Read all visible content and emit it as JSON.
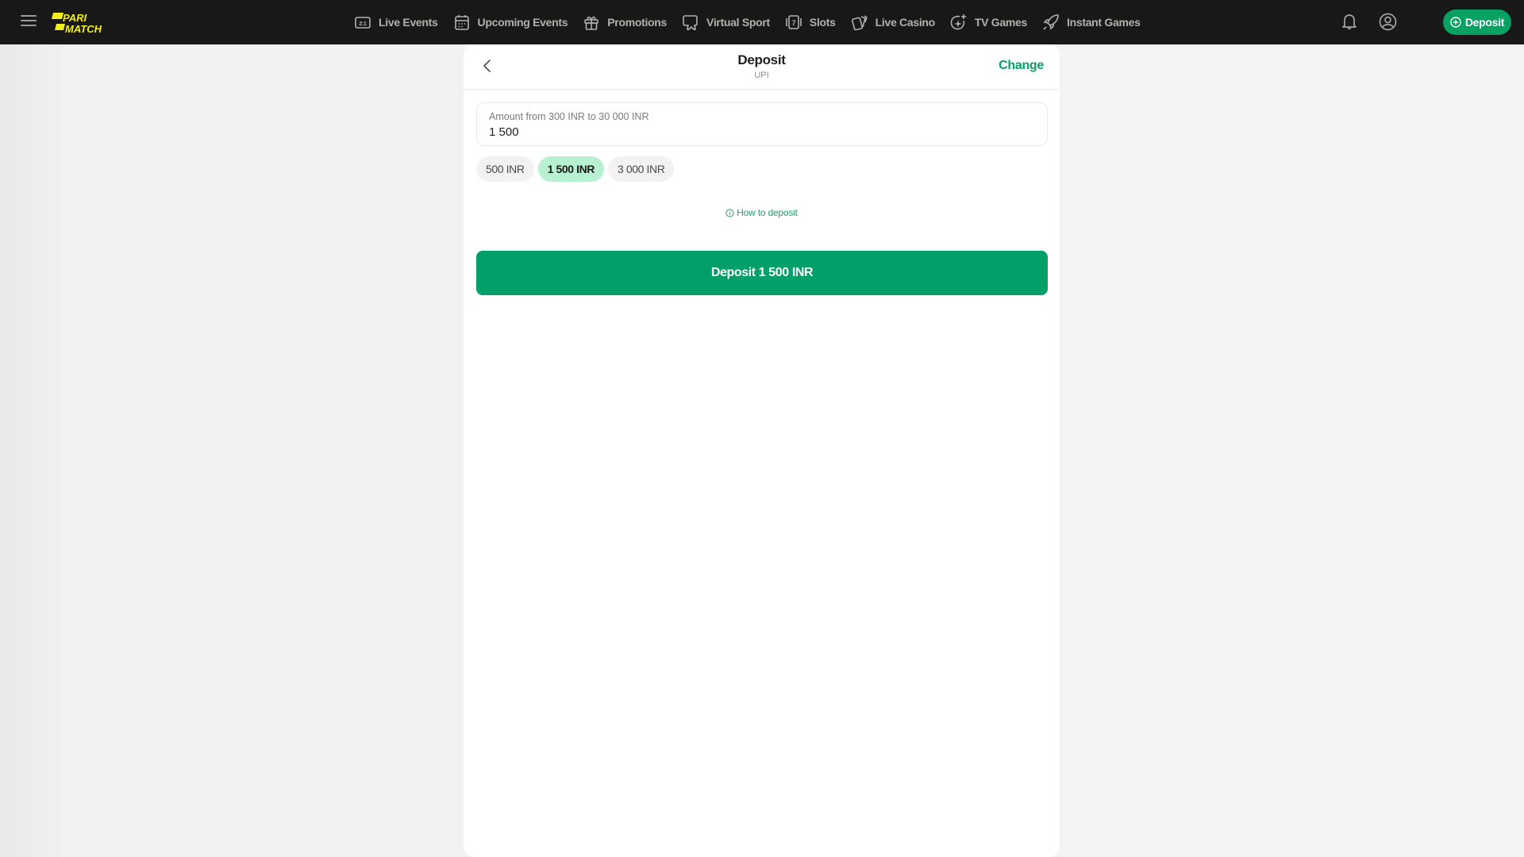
{
  "header": {
    "logo_line1": "PARI",
    "logo_line2": "MATCH",
    "nav": [
      {
        "label": "Live Events",
        "icon": "live-events-icon"
      },
      {
        "label": "Upcoming Events",
        "icon": "calendar-icon"
      },
      {
        "label": "Promotions",
        "icon": "gift-icon"
      },
      {
        "label": "Virtual Sport",
        "icon": "virtual-sport-icon"
      },
      {
        "label": "Slots",
        "icon": "slots-icon"
      },
      {
        "label": "Live Casino",
        "icon": "cards-icon"
      },
      {
        "label": "TV Games",
        "icon": "tv-games-icon"
      },
      {
        "label": "Instant Games",
        "icon": "rocket-icon"
      }
    ],
    "live_badge": "2:1",
    "slots_badge": "7",
    "deposit_label": "Deposit"
  },
  "panel": {
    "title": "Deposit",
    "subtitle": "UPI",
    "change_label": "Change",
    "amount": {
      "label": "Amount from 300 INR to 30 000 INR",
      "value": "1 500"
    },
    "chips": [
      {
        "label": "500 INR",
        "selected": false
      },
      {
        "label": "1 500 INR",
        "selected": true
      },
      {
        "label": "3 000 INR",
        "selected": false
      }
    ],
    "how_to_label": "How to deposit",
    "submit_label": "Deposit 1 500 INR"
  },
  "colors": {
    "brand_green": "#02a068",
    "logo_yellow": "#f4ed1e",
    "topbar_bg": "#181818",
    "chip_selected_bg": "#b7f1d1"
  }
}
